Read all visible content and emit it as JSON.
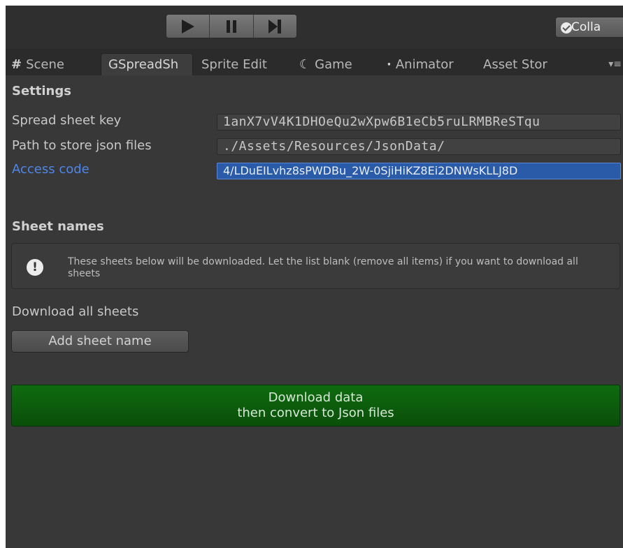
{
  "toolbar": {
    "play_icon": "play-icon",
    "pause_icon": "pause-icon",
    "step_icon": "step-icon",
    "collab_label": "Colla"
  },
  "tabs": [
    {
      "label": "Scene",
      "icon": "#"
    },
    {
      "label": "GSpreadSh"
    },
    {
      "label": "Sprite Edit"
    },
    {
      "label": "Game",
      "icon": "☾"
    },
    {
      "label": "Animator",
      "icon": "·"
    },
    {
      "label": "Asset Stor"
    }
  ],
  "settings": {
    "heading": "Settings",
    "spreadsheet_key_label": "Spread sheet key",
    "spreadsheet_key_value": "1anX7vV4K1DHOeQu2wXpw6B1eCb5ruLRMBReSTqu",
    "path_label": "Path to store json files",
    "path_value": "./Assets/Resources/JsonData/",
    "access_code_label": "Access code",
    "access_code_value": "4/LDuEILvhz8sPWDBu_2W-0SjiHiKZ8Ei2DNWsKLLJ8D"
  },
  "sheets": {
    "heading": "Sheet names",
    "help_text": "These sheets below will be downloaded. Let the list blank (remove all items) if you want to download all sheets",
    "download_all_label": "Download all sheets",
    "add_sheet_button": "Add sheet name"
  },
  "download": {
    "line1": "Download data",
    "line2": "then convert to Json files"
  },
  "colors": {
    "accent_blue": "#4f86e8",
    "download_green": "#0f6b0f"
  }
}
